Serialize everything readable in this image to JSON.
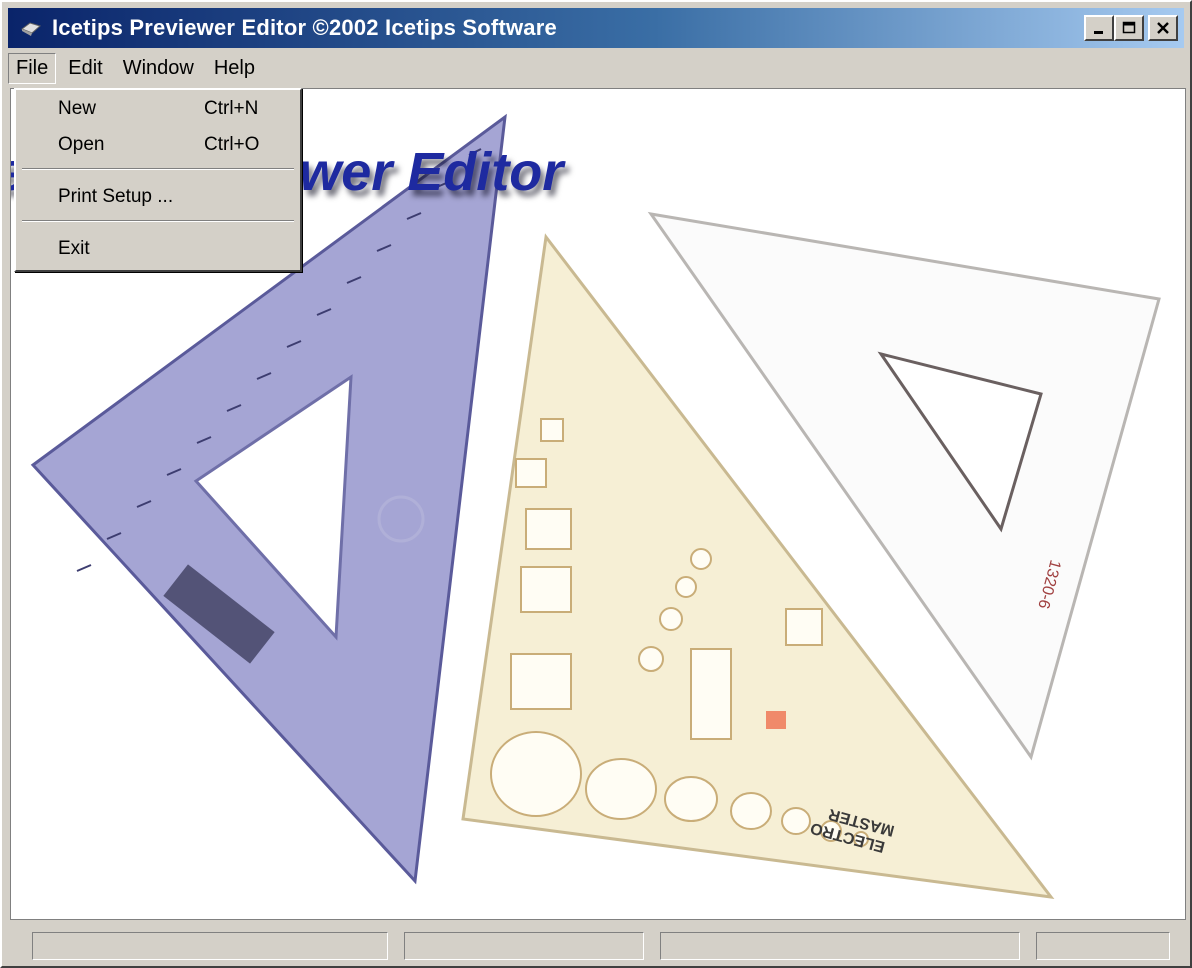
{
  "window": {
    "title": "Icetips Previewer Editor ©2002 Icetips Software",
    "minimize_glyph": "_",
    "maximize_glyph": "□",
    "close_glyph": "×"
  },
  "menubar": {
    "items": [
      {
        "label": "File",
        "active": true
      },
      {
        "label": "Edit",
        "active": false
      },
      {
        "label": "Window",
        "active": false
      },
      {
        "label": "Help",
        "active": false
      }
    ]
  },
  "file_menu": {
    "items": [
      {
        "label": "New",
        "shortcut": "Ctrl+N"
      },
      {
        "label": "Open",
        "shortcut": "Ctrl+O"
      },
      {
        "label": "Print Setup ...",
        "shortcut": ""
      },
      {
        "label": "Exit",
        "shortcut": ""
      }
    ]
  },
  "canvas": {
    "logo_text": "Icetips Previewer Editor",
    "triangle_labels": [
      "1320-6",
      "MASTER",
      "ELECTRO"
    ]
  },
  "statusbar": {
    "panels": [
      "",
      "",
      "",
      ""
    ]
  },
  "colors": {
    "title_start": "#0a246a",
    "title_end": "#a6caf0",
    "logo": "#1e2aa0",
    "face": "#d4d0c8"
  },
  "icons": [
    "app-icon",
    "minimize-icon",
    "maximize-icon",
    "close-icon"
  ]
}
